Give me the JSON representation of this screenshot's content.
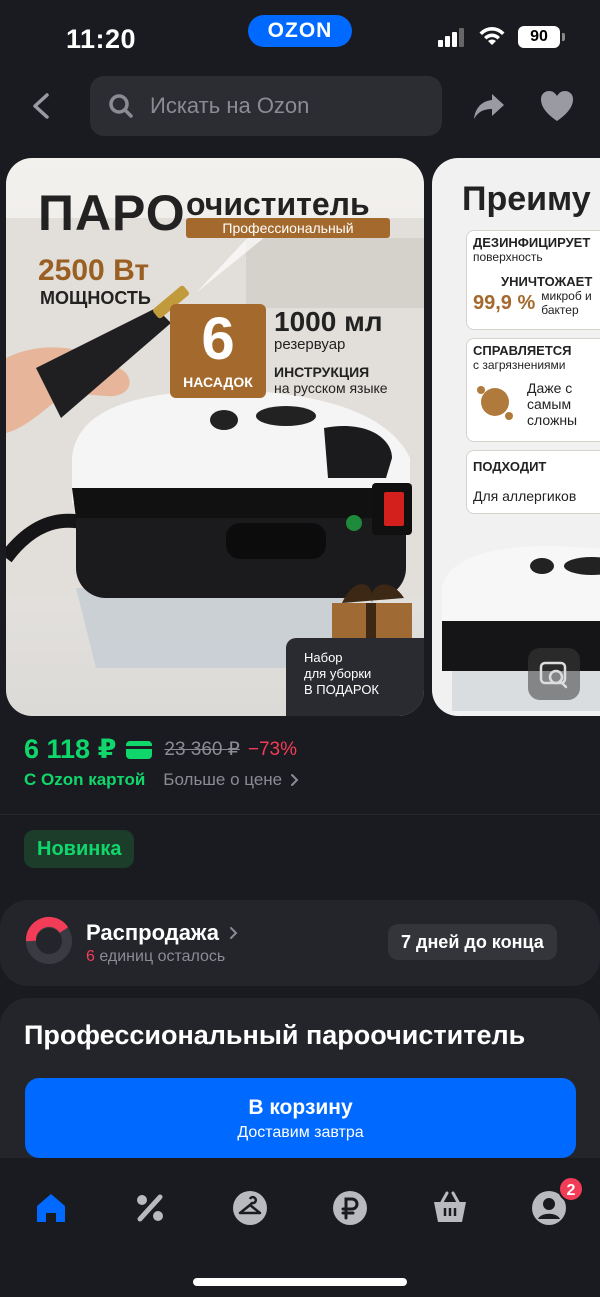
{
  "status_bar": {
    "time": "11:20",
    "app_badge": "OZON",
    "battery": "90"
  },
  "search": {
    "placeholder": "Искать на Ozon"
  },
  "gallery": {
    "slide1": {
      "title_big": "ПАРО",
      "title_rest": "очиститель",
      "subtitle": "Профессиональный",
      "power_value": "2500 Вт",
      "power_label": "МОЩНОСТЬ",
      "nozzles_count": "6",
      "nozzles_label": "НАСАДОК",
      "volume_value": "1000 мл",
      "volume_label": "резервуар",
      "instructions_title": "ИНСТРУКЦИЯ",
      "instructions_sub": "на русском языке",
      "gift_text": [
        "Набор",
        "для уборки",
        "В ПОДАРОК"
      ]
    },
    "slide2": {
      "title": "Преиму",
      "card1_head": "ДЕЗИНФИЦИРУЕТ",
      "card1_sub": "поверхность",
      "card1_line": "УНИЧТОЖАЕТ",
      "card1_pct": "99,9 %",
      "card1_tail": "микроб и бактер",
      "card2_head": "СПРАВЛЯЕТСЯ",
      "card2_sub": "с загрязнениями",
      "card2_text": "Даже с самым сложны",
      "card3_head": "ПОДХОДИТ",
      "card3_text": "Для аллергиков"
    }
  },
  "pricing": {
    "price": "6 118 ₽",
    "old_price": "23 360 ₽",
    "discount": "−73%",
    "card_text": "С Ozon картой",
    "more_price": "Больше о цене"
  },
  "badge_new": "Новинка",
  "sale": {
    "title": "Распродажа",
    "units_count": "6",
    "units_text": "единиц осталось",
    "days_left": "7 дней до конца"
  },
  "product": {
    "title": "Профессиональный пароочиститель"
  },
  "cart": {
    "label": "В корзину",
    "sub": "Доставим завтра"
  },
  "tab_bar": {
    "notification_count": "2"
  },
  "colors": {
    "accent_blue": "#0069ff",
    "price_green": "#10d76b",
    "discount_red": "#f33c58",
    "background": "#1a1b20"
  }
}
